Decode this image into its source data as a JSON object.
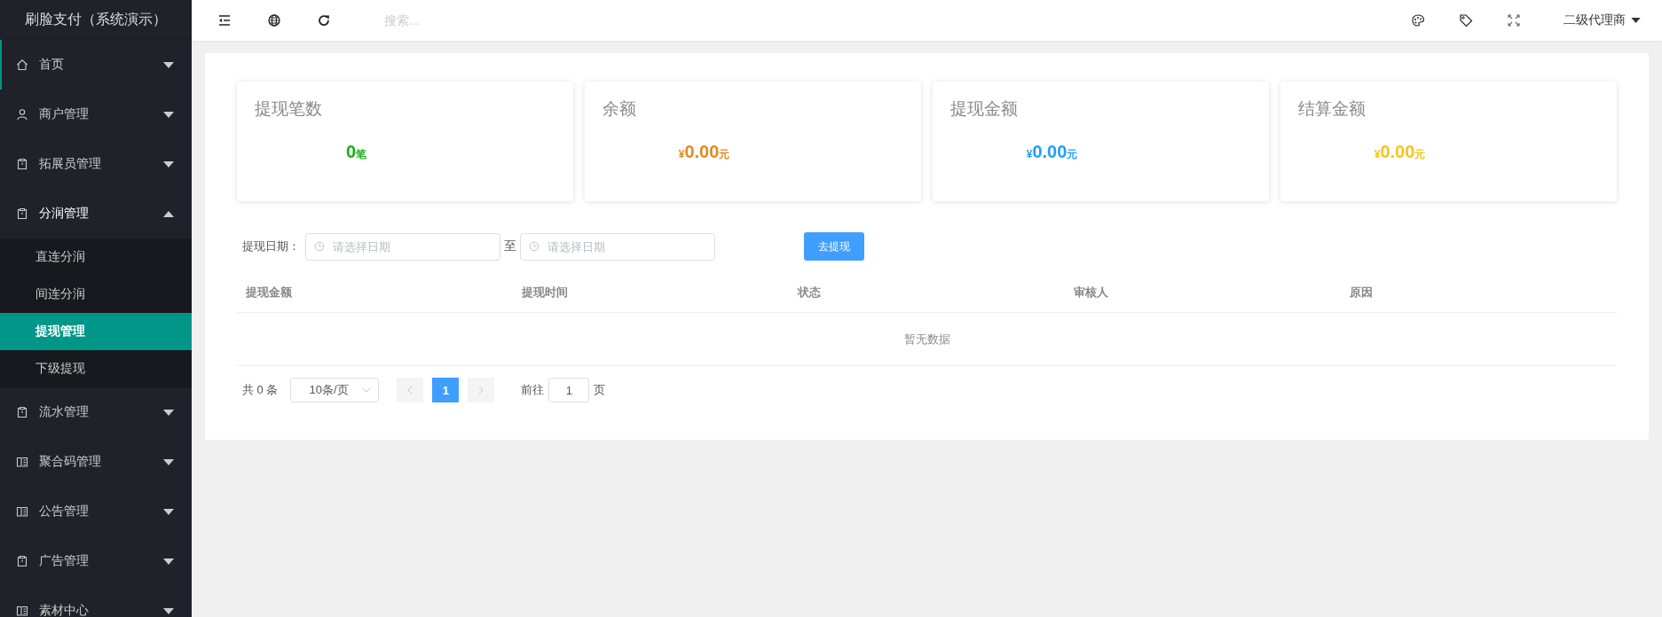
{
  "sidebar": {
    "title": "刷脸支付（系统演示）",
    "items": [
      {
        "label": "首页",
        "selected": true,
        "expanded": false
      },
      {
        "label": "商户管理",
        "selected": false,
        "expanded": false
      },
      {
        "label": "拓展员管理",
        "selected": false,
        "expanded": false
      },
      {
        "label": "分润管理",
        "selected": false,
        "expanded": true,
        "children": [
          {
            "label": "直连分润",
            "selected": false
          },
          {
            "label": "间连分润",
            "selected": false
          },
          {
            "label": "提现管理",
            "selected": true
          },
          {
            "label": "下级提现",
            "selected": false
          }
        ]
      },
      {
        "label": "流水管理",
        "selected": false,
        "expanded": false
      },
      {
        "label": "聚合码管理",
        "selected": false,
        "expanded": false
      },
      {
        "label": "公告管理",
        "selected": false,
        "expanded": false
      },
      {
        "label": "广告管理",
        "selected": false,
        "expanded": false
      },
      {
        "label": "素材中心",
        "selected": false,
        "expanded": false
      }
    ]
  },
  "topbar": {
    "search": {
      "placeholder": "搜索..."
    },
    "user": "二级代理商"
  },
  "cards": [
    {
      "title": "提现笔数",
      "amount": "0",
      "unit": "笔",
      "color": "#1aad19"
    },
    {
      "title": "余额",
      "currency": "¥",
      "amount": "0.00",
      "unit": "元",
      "color": "#e08a1e"
    },
    {
      "title": "提现金额",
      "currency": "¥",
      "amount": "0.00",
      "unit": "元",
      "color": "#1e9fff"
    },
    {
      "title": "结算金额",
      "currency": "¥",
      "amount": "0.00",
      "unit": "元",
      "color": "#f5c518"
    }
  ],
  "filter": {
    "label": "提现日期：",
    "start": {
      "placeholder": "请选择日期"
    },
    "separator": "至",
    "end": {
      "placeholder": "请选择日期"
    },
    "button": "去提现"
  },
  "table": {
    "columns": [
      "提现金额",
      "提现时间",
      "状态",
      "审核人",
      "原因"
    ],
    "empty_text": "暂无数据"
  },
  "pagination": {
    "total": "共 0 条",
    "page_size": "10条/页",
    "prev_disabled": true,
    "next_disabled": true,
    "pages": [
      {
        "label": "1",
        "selected": true
      }
    ],
    "goto_label": "前往",
    "goto_value": "1",
    "goto_unit": "页"
  }
}
